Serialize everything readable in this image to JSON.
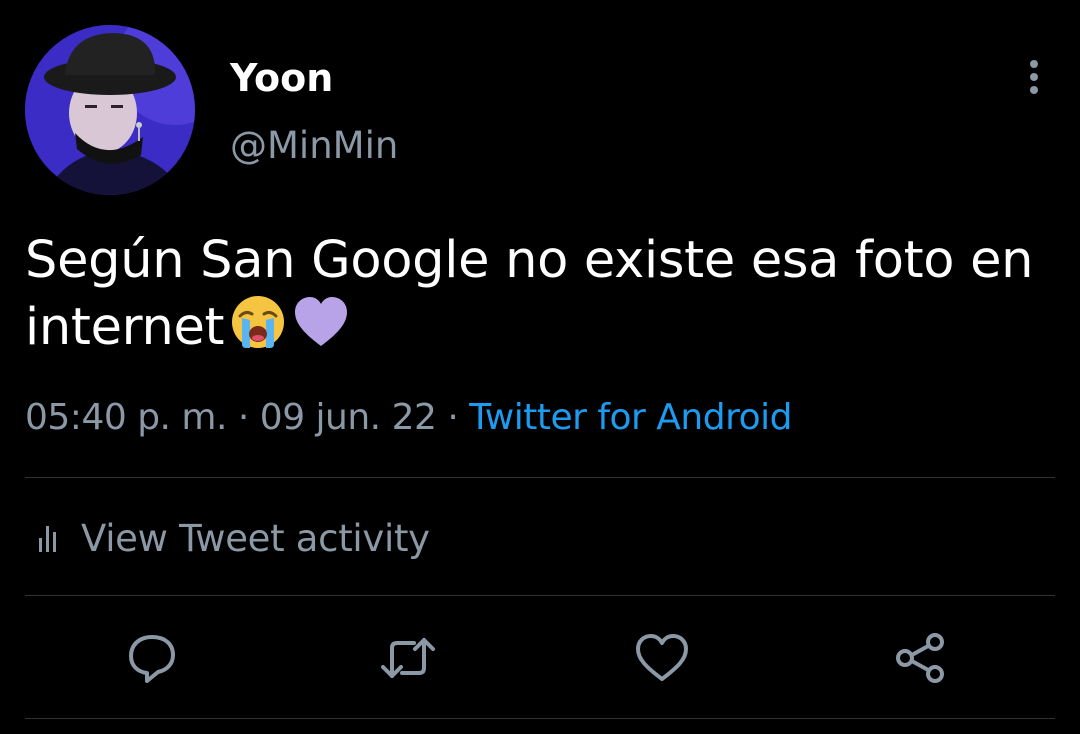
{
  "tweet": {
    "author": {
      "display_name": "Yoon",
      "handle": "@MinMin"
    },
    "text_line1": "Según San Google no existe esa foto en",
    "text_line2": "internet",
    "emojis": [
      "loudly-crying-face",
      "purple-heart"
    ],
    "time": "05:40 p. m.",
    "separator": " · ",
    "date": "09 jun. 22",
    "source": "Twitter for Android"
  },
  "activity": {
    "label": "View Tweet activity"
  },
  "actions": [
    {
      "icon": "reply-icon"
    },
    {
      "icon": "retweet-icon"
    },
    {
      "icon": "like-icon"
    },
    {
      "icon": "share-icon"
    }
  ],
  "colors": {
    "background": "#000000",
    "primary_text": "#ffffff",
    "secondary_text": "#8b98a5",
    "link": "#1d9bf0",
    "divider": "#2f3336"
  }
}
